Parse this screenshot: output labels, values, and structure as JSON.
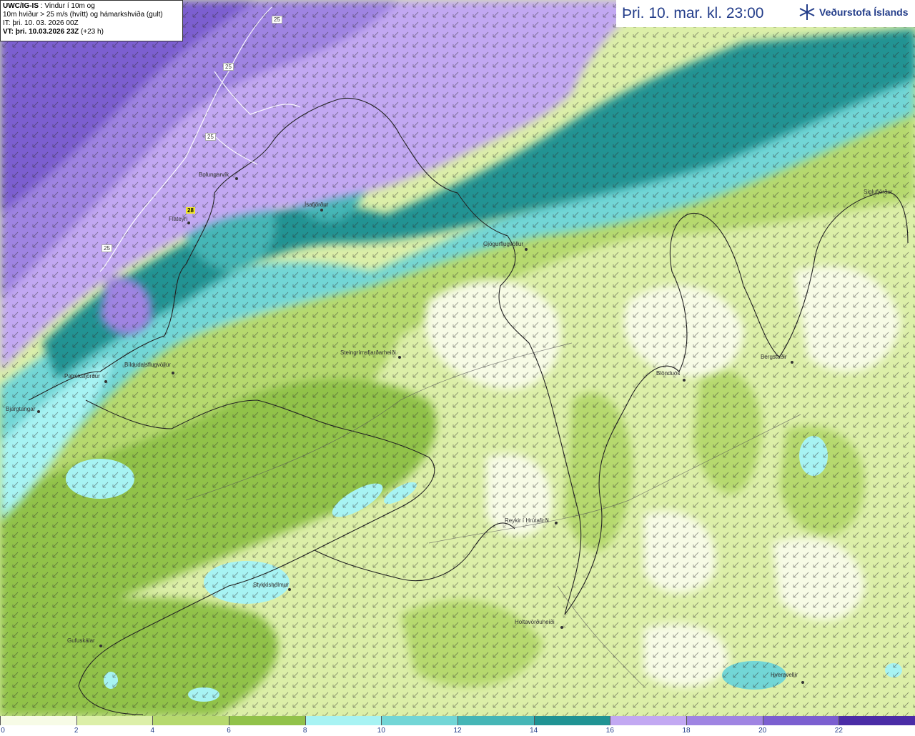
{
  "info": {
    "model": "UWC/IG-IS",
    "line1_rest": " : Vindur í 10m og",
    "line2": "10m hviður > 25 m/s (hvítt) og hámarkshviða (gult)",
    "line3": "IT: þri. 10. 03. 2026 00Z",
    "line4_bold": "VT: þri. 10.03.2026 23Z",
    "line4_rest": " (+23 h)"
  },
  "header": {
    "title": "Þri. 10. mar. kl. 23:00",
    "logo_icon": "snowflake-icon",
    "logo_text": "Veðurstofa Íslands"
  },
  "legend": {
    "colors": [
      "#f7fbe6",
      "#dcefa8",
      "#b6d96e",
      "#91c24a",
      "#a7f3f3",
      "#72d6d6",
      "#45b6b6",
      "#209393",
      "#c2a8f2",
      "#9f84e2",
      "#7b5fd0",
      "#4a2ca6"
    ],
    "ticks": [
      "0",
      "2",
      "4",
      "6",
      "8",
      "10",
      "12",
      "14",
      "16",
      "18",
      "20",
      "22"
    ]
  },
  "places": [
    {
      "name": "Bolungarvík"
    },
    {
      "name": "Ísafjörður"
    },
    {
      "name": "Flateyri"
    },
    {
      "name": "Gjögurflugvöllur"
    },
    {
      "name": "Siglufjörður"
    },
    {
      "name": "Steingrímsfjarðarheiði"
    },
    {
      "name": "Bíldudalsflugvöllur"
    },
    {
      "name": "Patreksfjörður"
    },
    {
      "name": "Bjargtangar"
    },
    {
      "name": "Blönduós"
    },
    {
      "name": "Bergstaðir"
    },
    {
      "name": "Reykir í Hrútafirði"
    },
    {
      "name": "Stykkishólmur"
    },
    {
      "name": "Holtavörðuheiði"
    },
    {
      "name": "Gufuskálar"
    },
    {
      "name": "Hveravellir"
    }
  ],
  "contour_labels": [
    "25",
    "25",
    "25",
    "25"
  ],
  "max_gust": "28"
}
